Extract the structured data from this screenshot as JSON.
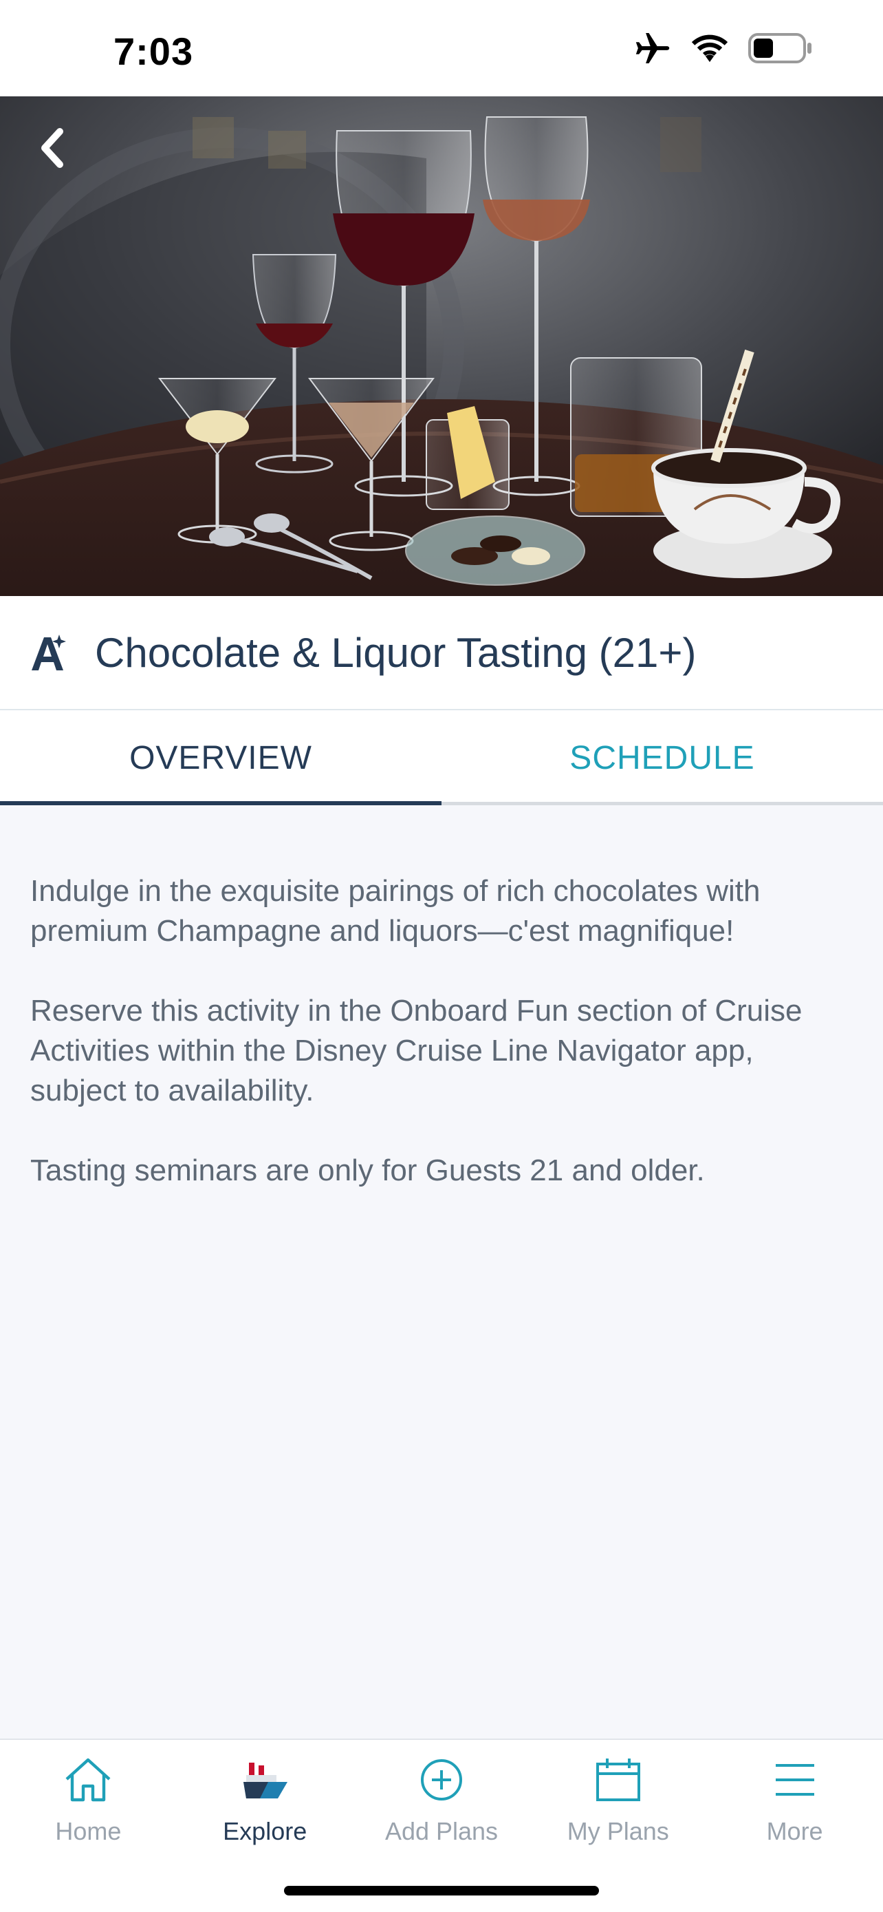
{
  "status_bar": {
    "time": "7:03",
    "icons": [
      "airplane-icon",
      "wifi-icon",
      "battery-icon"
    ]
  },
  "hero": {
    "image": "chocolate-and-liquor-glasses-photo",
    "back_icon": "chevron-left-icon"
  },
  "title": {
    "icon": "activity-star-icon",
    "text": "Chocolate & Liquor Tasting (21+)"
  },
  "tabs": [
    {
      "label": "OVERVIEW",
      "active": true
    },
    {
      "label": "SCHEDULE",
      "active": false
    }
  ],
  "overview": {
    "paragraphs": [
      "Indulge in the exquisite pairings of rich chocolates with premium Champagne and liquors—c'est magnifique!",
      "Reserve this activity in the Onboard Fun section of Cruise Activities within the Disney Cruise Line Navigator app, subject to availability.",
      "Tasting seminars are only for Guests 21 and older."
    ]
  },
  "tab_bar": {
    "items": [
      {
        "label": "Home",
        "icon": "home-icon",
        "active": false
      },
      {
        "label": "Explore",
        "icon": "ship-icon",
        "active": true
      },
      {
        "label": "Add Plans",
        "icon": "plus-circle-icon",
        "active": false
      },
      {
        "label": "My Plans",
        "icon": "calendar-icon",
        "active": false
      },
      {
        "label": "More",
        "icon": "menu-icon",
        "active": false
      }
    ]
  },
  "colors": {
    "navy": "#253b56",
    "teal": "#1fa0b8",
    "body_text": "#5d6875",
    "inactive": "#9aa3ad",
    "background": "#f6f7fb"
  }
}
